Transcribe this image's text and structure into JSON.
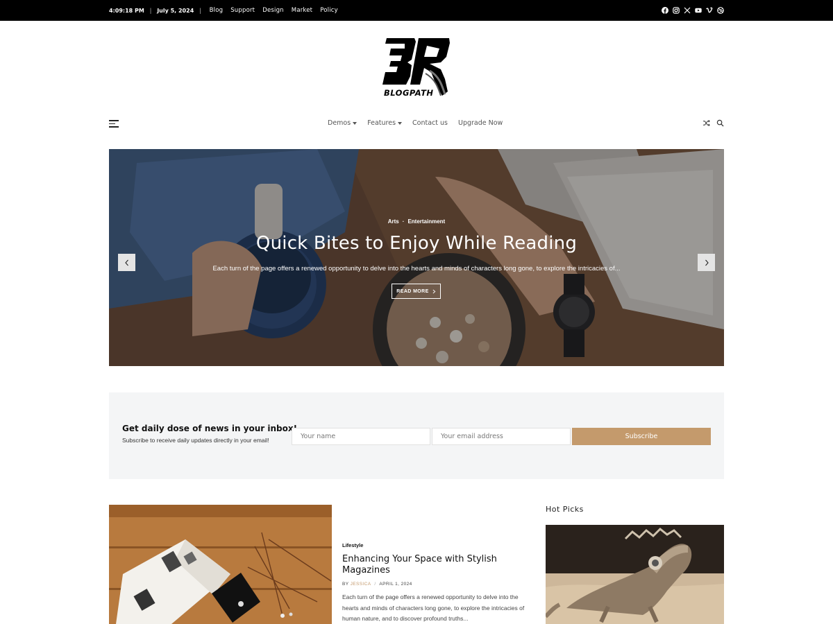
{
  "topbar": {
    "time": "4:09:18 PM",
    "separator": "|",
    "date": "July 5, 2024",
    "links": [
      "Blog",
      "Support",
      "Design",
      "Market",
      "Policy"
    ],
    "social_icons": [
      "facebook-icon",
      "instagram-icon",
      "x-twitter-icon",
      "youtube-icon",
      "vimeo-icon",
      "dribbble-icon"
    ]
  },
  "brand": {
    "name": "BLOGPATH",
    "logo_letters": "BP"
  },
  "nav": {
    "items": [
      {
        "label": "Demos",
        "has_dropdown": true
      },
      {
        "label": "Features",
        "has_dropdown": true
      },
      {
        "label": "Contact us",
        "has_dropdown": false
      },
      {
        "label": "Upgrade Now",
        "has_dropdown": false
      }
    ],
    "icons": [
      "menu-icon",
      "shuffle-icon",
      "search-icon"
    ]
  },
  "hero": {
    "categories": [
      "Arts",
      "Entertainment"
    ],
    "category_separator": "·",
    "title": "Quick Bites to Enjoy While Reading",
    "excerpt": "Each turn of the page offers a renewed opportunity to delve into the hearts and minds of characters long gone, to explore the intricacies of...",
    "read_more": "READ MORE"
  },
  "newsletter": {
    "heading": "Get daily dose of news in your inbox!",
    "subtext": "Subscribe to receive daily updates directly in your email!",
    "name_placeholder": "Your name",
    "email_placeholder": "Your email address",
    "button_label": "Subscribe"
  },
  "article": {
    "category": "Lifestyle",
    "title": "Enhancing Your Space with Stylish Magazines",
    "by": "BY",
    "author": "JESSICA",
    "meta_separator": "/",
    "date": "APRIL 1, 2024",
    "excerpt": "Each turn of the page offers a renewed opportunity to delve into the hearts and minds of characters long gone, to explore the intricacies of human nature, and to discover profound truths..."
  },
  "sidebar": {
    "title": "Hot Picks"
  },
  "colors": {
    "accent": "#c49a6c",
    "topbar_bg": "#000000",
    "newsletter_bg": "#f4f5f6"
  }
}
